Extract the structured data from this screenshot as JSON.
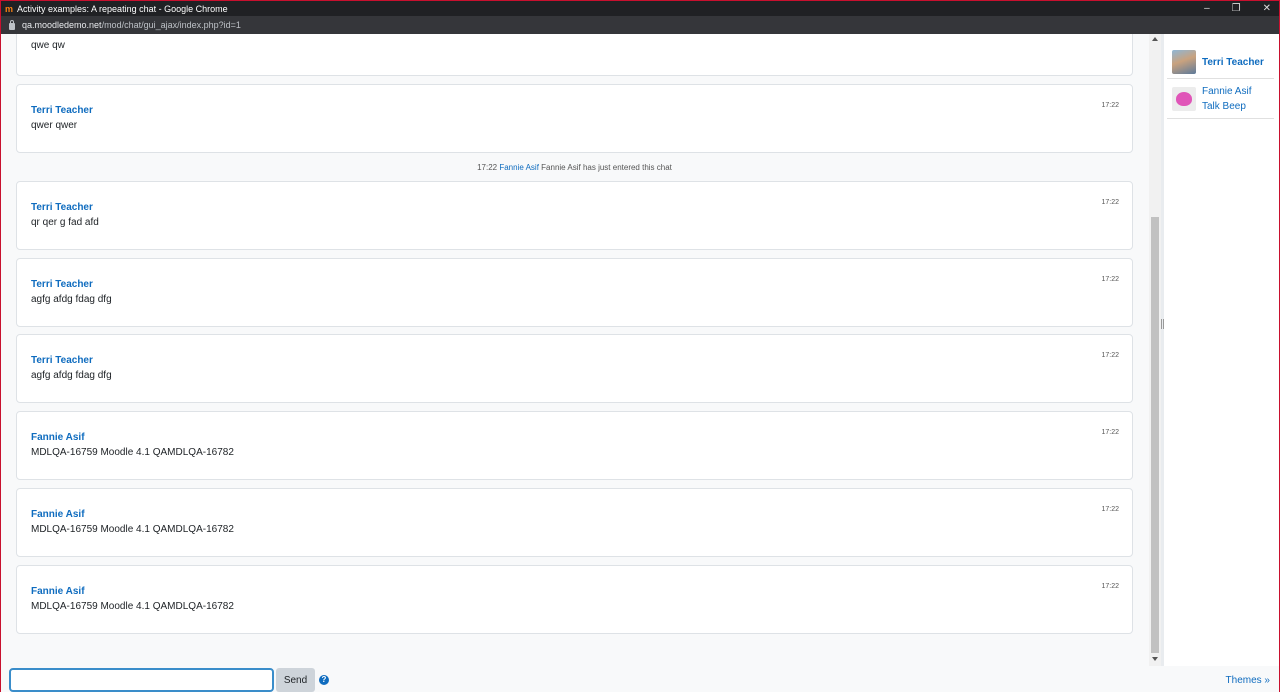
{
  "window": {
    "title": "Activity examples: A repeating chat - Google Chrome",
    "logo_text": "m",
    "url_host": "qa.moodledemo.net",
    "url_path": "/mod/chat/gui_ajax/index.php?id=1",
    "controls": [
      "–",
      "❐",
      "✕"
    ]
  },
  "chat": {
    "messages": [
      {
        "author": "",
        "text": "qwe qw",
        "time": ""
      },
      {
        "author": "Terri Teacher",
        "text": "qwer qwer",
        "time": "17:22"
      },
      {
        "author": "Terri Teacher",
        "text": "qr qer g fad afd",
        "time": "17:22"
      },
      {
        "author": "Terri Teacher",
        "text": "agfg afdg fdag dfg",
        "time": "17:22"
      },
      {
        "author": "Terri Teacher",
        "text": "agfg afdg fdag dfg",
        "time": "17:22"
      },
      {
        "author": "Fannie Asif",
        "text": "MDLQA-16759 Moodle 4.1 QAMDLQA-16782",
        "time": "17:22"
      },
      {
        "author": "Fannie Asif",
        "text": "MDLQA-16759 Moodle 4.1 QAMDLQA-16782",
        "time": "17:22"
      },
      {
        "author": "Fannie Asif",
        "text": "MDLQA-16759 Moodle 4.1 QAMDLQA-16782",
        "time": "17:22"
      }
    ],
    "event": {
      "time": "17:22",
      "user": "Fannie Asif",
      "text": "Fannie Asif has just entered this chat"
    }
  },
  "users": {
    "list": [
      {
        "name": "Terri Teacher"
      },
      {
        "name": "Fannie Asif",
        "action": "Talk Beep"
      }
    ]
  },
  "input": {
    "value": "",
    "send_label": "Send",
    "help_glyph": "?"
  },
  "footer": {
    "themes_label": "Themes »"
  }
}
